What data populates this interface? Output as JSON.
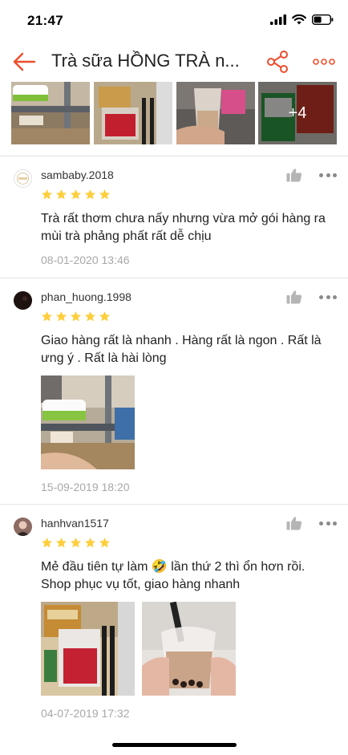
{
  "status_bar": {
    "time": "21:47"
  },
  "header": {
    "title": "Trà sữa HỒNG TRÀ n..."
  },
  "top_strip": {
    "more_badge": "+4"
  },
  "reviews": [
    {
      "username": "sambaby.2018",
      "text": "Trà rất thơm chưa nấy nhưng vừa mở gói hàng ra mùi trà phảng phất rất dễ chịu",
      "date": "08-01-2020 13:46",
      "rating": 5
    },
    {
      "username": "phan_huong.1998",
      "text": "Giao hàng rất là nhanh . Hàng rất là ngon . Rất là ưng ý . Rất là hài lòng",
      "date": "15-09-2019 18:20",
      "rating": 5
    },
    {
      "username": "hanhvan1517",
      "text": "Mẻ đầu tiên tự làm 🤣 lần thứ 2 thì ổn hơn rồi. Shop phục vụ tốt, giao hàng nhanh",
      "date": "04-07-2019 17:32",
      "rating": 5
    }
  ],
  "colors": {
    "accent": "#ee4d2d",
    "star": "#ffce3d",
    "muted_text": "#a8a8a8",
    "divider": "#e4e4e4"
  },
  "icons": {
    "back": "arrow-left-icon",
    "share": "share-icon",
    "more": "more-dots-icon",
    "like": "thumbs-up-icon"
  }
}
